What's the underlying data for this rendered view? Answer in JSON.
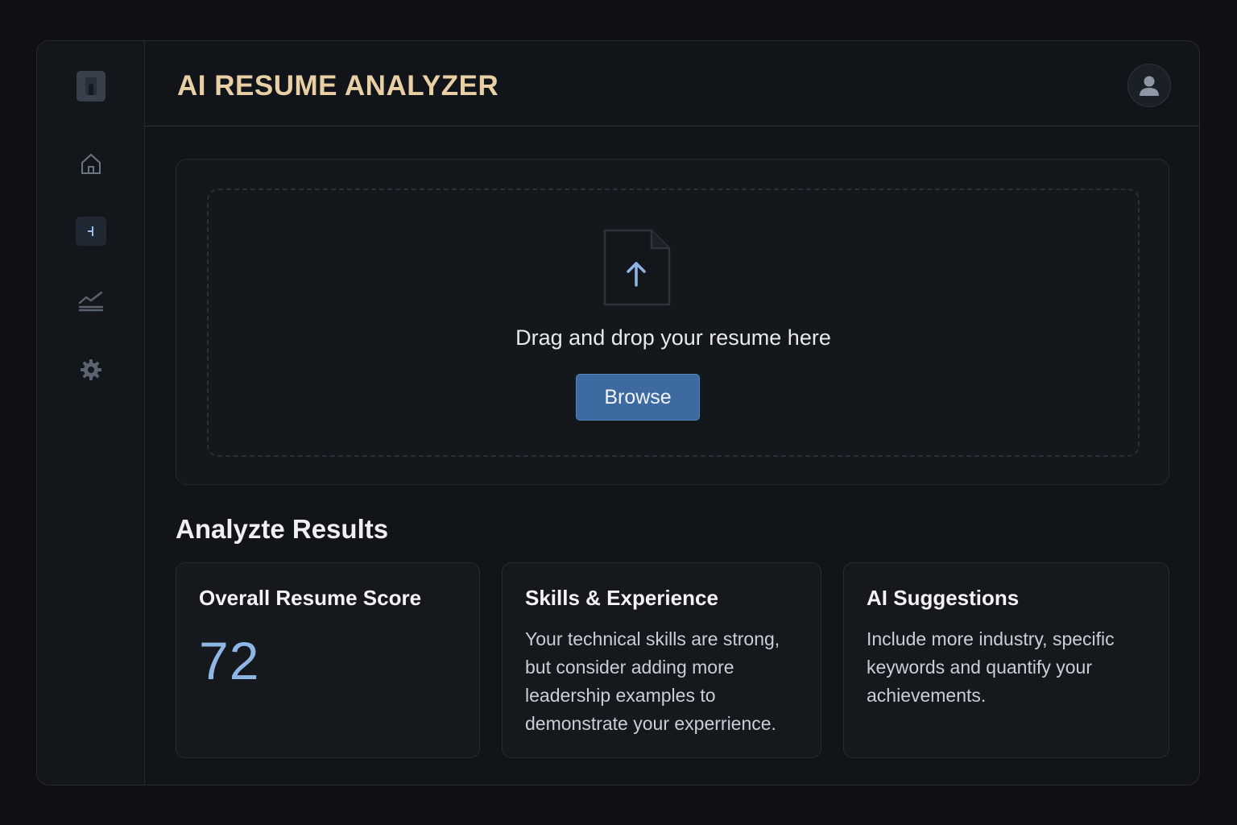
{
  "app": {
    "title": "AI RESUME ANALYZER"
  },
  "sidebar": {
    "items": [
      {
        "icon": "logo-icon"
      },
      {
        "icon": "home-icon"
      },
      {
        "icon": "documents-icon",
        "active": true
      },
      {
        "icon": "analytics-icon"
      },
      {
        "icon": "settings-icon"
      }
    ]
  },
  "header": {
    "avatar_icon": "user-avatar-icon"
  },
  "upload": {
    "icon": "file-upload-icon",
    "prompt": "Drag and drop your resume here",
    "browse_label": "Browse"
  },
  "results": {
    "heading": "Analyzte Results",
    "cards": [
      {
        "title": "Overall Resume Score",
        "score": "72"
      },
      {
        "title": "Skills & Experience",
        "body": "Your technical skills are strong, but consider adding more leadership examples to demonstrate your experrience."
      },
      {
        "title": "AI Suggestions",
        "body": "Include more industry, specific keywords and quantify your achievements."
      }
    ]
  },
  "colors": {
    "background": "#0e1014",
    "panel": "#111419",
    "title_accent": "#e8cfa4",
    "button": "#3d6aa1",
    "score": "#8fb7e6"
  }
}
